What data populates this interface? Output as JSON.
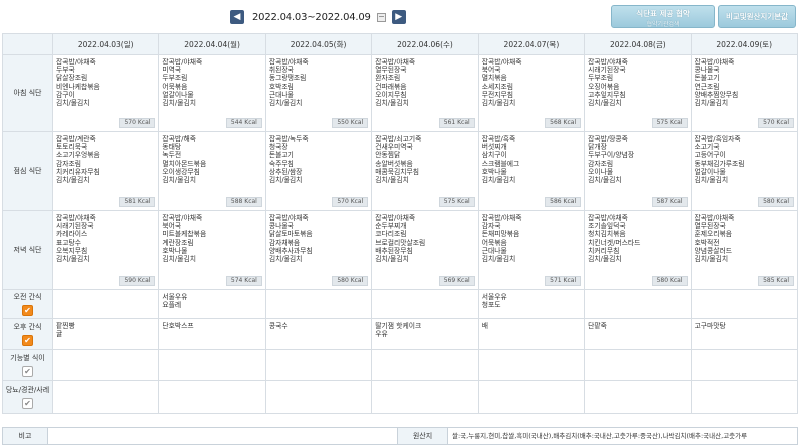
{
  "nav": {
    "prev_icon": "◀",
    "next_icon": "▶",
    "date_range": "2022.04.03~2022.04.09"
  },
  "buttons": {
    "provide_line1": "식단표 제공 협약",
    "provide_line2": "협약기관검색",
    "compare": "비교및원산지기본값"
  },
  "days": [
    {
      "label": "2022.04.03(일)",
      "type": "sun"
    },
    {
      "label": "2022.04.04(월)",
      "type": "weekday"
    },
    {
      "label": "2022.04.05(화)",
      "type": "weekday"
    },
    {
      "label": "2022.04.06(수)",
      "type": "weekday"
    },
    {
      "label": "2022.04.07(목)",
      "type": "weekday"
    },
    {
      "label": "2022.04.08(금)",
      "type": "weekday"
    },
    {
      "label": "2022.04.09(토)",
      "type": "sat"
    }
  ],
  "rows": [
    {
      "label": "아침 식단",
      "checkbox": null,
      "cells": [
        {
          "items": [
            "잡곡밥/야채죽",
            "두부국",
            "닭살장조림",
            "비엔나케찹볶음",
            "감구이",
            "김치/물김치"
          ],
          "kcal": "570 Kcal"
        },
        {
          "items": [
            "잡곡밥/야채죽",
            "미역국",
            "두부조림",
            "어묵볶음",
            "얼갈이나물",
            "김치/물김치"
          ],
          "kcal": "544 Kcal"
        },
        {
          "items": [
            "잡곡밥/야채죽",
            "취된장국",
            "동그랑땡조림",
            "호박조림",
            "근대나물",
            "김치/물김치"
          ],
          "kcal": "550 Kcal"
        },
        {
          "items": [
            "잡곡밥/야채죽",
            "열무된장국",
            "완자조림",
            "건파래볶음",
            "오이지무침",
            "김치/물김치"
          ],
          "kcal": "561 Kcal"
        },
        {
          "items": [
            "잡곡밥/야채죽",
            "북어국",
            "멸치볶음",
            "소세지조림",
            "무전지무침",
            "김치/물김치"
          ],
          "kcal": "568 Kcal"
        },
        {
          "items": [
            "잡곡밥/야채죽",
            "시래기된장국",
            "두부조림",
            "오징어볶음",
            "고추잎지무침",
            "김치/물김치"
          ],
          "kcal": "575 Kcal"
        },
        {
          "items": [
            "잡곡밥/야채죽",
            "콩나물국",
            "돈불고기",
            "연근조림",
            "양배추찜앙무침",
            "김치/물김치"
          ],
          "kcal": "570 Kcal"
        }
      ]
    },
    {
      "label": "점심 식단",
      "checkbox": null,
      "cells": [
        {
          "items": [
            "잡곡밥/계란죽",
            "토토리묵국",
            "소고기우엉볶음",
            "감자조림",
            "치커리유자무침",
            "김치/물김치"
          ],
          "kcal": "581 Kcal"
        },
        {
          "items": [
            "잡곡밥/해죽",
            "동태탕",
            "녹두전",
            "멸치아몬드볶음",
            "오이생강무침",
            "김치/물김치"
          ],
          "kcal": "588 Kcal"
        },
        {
          "items": [
            "잡곡밥/녹두죽",
            "청국장",
            "돈볼고기",
            "숙주무침",
            "상추된/쌈장",
            "김치/물김치"
          ],
          "kcal": "570 Kcal"
        },
        {
          "items": [
            "잡곡밥/쇠고기죽",
            "건새우미역국",
            "안동찜닭",
            "송알버섯볶음",
            "매콤묵김치무침",
            "김치/물김치"
          ],
          "kcal": "575 Kcal"
        },
        {
          "items": [
            "잡곡밥/흑죽",
            "버섯찌개",
            "삼치구이",
            "스크램블에그",
            "호박나물",
            "김치/물김치"
          ],
          "kcal": "586 Kcal"
        },
        {
          "items": [
            "잡곡밥/땅콩죽",
            "닭개장",
            "두부구이/양념장",
            "감자조림",
            "오이나물",
            "김치/물김치"
          ],
          "kcal": "587 Kcal"
        },
        {
          "items": [
            "잡곡밥/흑임자죽",
            "소고기국",
            "고등어구이",
            "동부채김가루조림",
            "얼갈이나물",
            "김치/물김치"
          ],
          "kcal": "580 Kcal"
        }
      ]
    },
    {
      "label": "저녁 식단",
      "checkbox": null,
      "cells": [
        {
          "items": [
            "잡곡밥/야채죽",
            "시래기된장국",
            "카레라이스",
            "표고탕수",
            "오복지무침",
            "김치/물김치"
          ],
          "kcal": "590 Kcal"
        },
        {
          "items": [
            "잡곡밥/야채죽",
            "북어국",
            "미트볼케찹볶음",
            "계란장조림",
            "호박나물",
            "김치/물김치"
          ],
          "kcal": "574 Kcal"
        },
        {
          "items": [
            "잡곡밥/야채죽",
            "콩나물국",
            "닭살토마토볶음",
            "감자채볶음",
            "양배추사과무침",
            "김치/물김치"
          ],
          "kcal": "580 Kcal"
        },
        {
          "items": [
            "잡곡밥/야채죽",
            "순두부찌개",
            "코다리조림",
            "브로컬리맛살조림",
            "배추된장무침",
            "김치/물김치"
          ],
          "kcal": "569 Kcal"
        },
        {
          "items": [
            "잡곡밥/야채죽",
            "감자국",
            "돈채피망볶음",
            "어묵볶음",
            "근대나물",
            "김치/물김치"
          ],
          "kcal": "571 Kcal"
        },
        {
          "items": [
            "잡곡밥/야채죽",
            "조기솔잎덕국",
            "청치김치볶음",
            "치킨너겟/머스타드",
            "치커리무침",
            "김치/물김치"
          ],
          "kcal": "580 Kcal"
        },
        {
          "items": [
            "잡곡밥/야채죽",
            "열무된장국",
            "훈제오리볶음",
            "호박적전",
            "양념콩살러드",
            "김치/물김치"
          ],
          "kcal": "585 Kcal"
        }
      ]
    },
    {
      "label": "오전 간식",
      "checkbox": "orange",
      "cells": [
        {
          "items": [],
          "kcal": ""
        },
        {
          "items": [
            "서울우유",
            "요플레"
          ],
          "kcal": ""
        },
        {
          "items": [],
          "kcal": ""
        },
        {
          "items": [],
          "kcal": ""
        },
        {
          "items": [
            "서울우유",
            "청포도"
          ],
          "kcal": ""
        },
        {
          "items": [],
          "kcal": ""
        },
        {
          "items": [],
          "kcal": ""
        }
      ]
    },
    {
      "label": "오후 간식",
      "checkbox": "orange",
      "cells": [
        {
          "items": [
            "팥찐빵",
            "귤"
          ],
          "kcal": ""
        },
        {
          "items": [
            "단호박스프"
          ],
          "kcal": ""
        },
        {
          "items": [
            "콩국수"
          ],
          "kcal": ""
        },
        {
          "items": [
            "딸기잼 핫케이크",
            "우유"
          ],
          "kcal": ""
        },
        {
          "items": [
            "배"
          ],
          "kcal": ""
        },
        {
          "items": [
            "단팥죽"
          ],
          "kcal": ""
        },
        {
          "items": [
            "고구마맛탕"
          ],
          "kcal": ""
        }
      ]
    },
    {
      "label": "기능별 식이",
      "checkbox": "gray",
      "cells": [
        {
          "items": [],
          "kcal": ""
        },
        {
          "items": [],
          "kcal": ""
        },
        {
          "items": [],
          "kcal": ""
        },
        {
          "items": [],
          "kcal": ""
        },
        {
          "items": [],
          "kcal": ""
        },
        {
          "items": [],
          "kcal": ""
        },
        {
          "items": [],
          "kcal": ""
        }
      ]
    },
    {
      "label": "당뇨/경관/사레",
      "checkbox": "gray",
      "cells": [
        {
          "items": [],
          "kcal": ""
        },
        {
          "items": [],
          "kcal": ""
        },
        {
          "items": [],
          "kcal": ""
        },
        {
          "items": [],
          "kcal": ""
        },
        {
          "items": [],
          "kcal": ""
        },
        {
          "items": [],
          "kcal": ""
        },
        {
          "items": [],
          "kcal": ""
        }
      ]
    }
  ],
  "checkbox_mark": "✔",
  "footer": {
    "note_label": "비고",
    "note_value": "",
    "origin_label": "원산지",
    "origin_value": "쌀:국,누룽지,현미,찹쌀,흑미(국내산),배추김치(배추:국내산,고춧가루:중국산),나박김치(배추:국내산,고춧가루"
  }
}
